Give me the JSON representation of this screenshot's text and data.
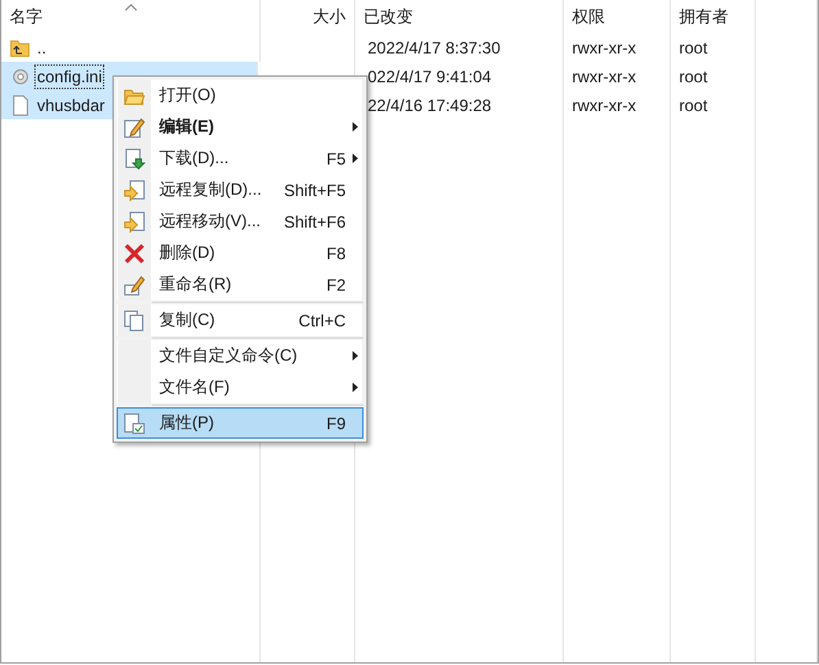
{
  "columns": [
    {
      "label": "名字",
      "sorted": true
    },
    {
      "label": "大小"
    },
    {
      "label": "已改变"
    },
    {
      "label": "权限"
    },
    {
      "label": "拥有者"
    }
  ],
  "rows": [
    {
      "kind": "parent",
      "name": "..",
      "modified": "2022/4/17 8:37:30",
      "permissions": "rwxr-xr-x",
      "owner": "root",
      "selected": false,
      "focused": false
    },
    {
      "kind": "config",
      "name": "config.ini",
      "modified": "022/4/17 9:41:04",
      "permissions": "rwxr-xr-x",
      "owner": "root",
      "selected": true,
      "focused": true
    },
    {
      "kind": "file",
      "name": "vhusbdar",
      "modified": "22/4/16 17:49:28",
      "permissions": "rwxr-xr-x",
      "owner": "root",
      "selected": true,
      "focused": false
    }
  ],
  "context_menu": [
    {
      "kind": "open",
      "label": "打开(O)",
      "submenu": false,
      "bold": false,
      "selected": false
    },
    {
      "kind": "edit",
      "label": "编辑(E)",
      "submenu": true,
      "bold": true,
      "selected": false
    },
    {
      "kind": "download",
      "label": "下载(D)...",
      "shortcut": "F5",
      "submenu": true,
      "bold": false,
      "selected": false
    },
    {
      "kind": "remote-copy",
      "label": "远程复制(D)...",
      "shortcut": "Shift+F5",
      "submenu": false,
      "bold": false,
      "selected": false
    },
    {
      "kind": "remote-move",
      "label": "远程移动(V)...",
      "shortcut": "Shift+F6",
      "submenu": false,
      "bold": false,
      "selected": false
    },
    {
      "kind": "delete",
      "label": "删除(D)",
      "shortcut": "F8",
      "submenu": false,
      "bold": false,
      "selected": false
    },
    {
      "kind": "rename",
      "label": "重命名(R)",
      "shortcut": "F2",
      "submenu": false,
      "bold": false,
      "selected": false,
      "separator_after": true
    },
    {
      "kind": "copy",
      "label": "复制(C)",
      "shortcut": "Ctrl+C",
      "submenu": false,
      "bold": false,
      "selected": false,
      "separator_after": true
    },
    {
      "kind": "plain",
      "label": "文件自定义命令(C)",
      "submenu": true,
      "bold": false,
      "selected": false
    },
    {
      "kind": "plain",
      "label": "文件名(F)",
      "submenu": true,
      "bold": false,
      "selected": false,
      "separator_after": true
    },
    {
      "kind": "properties",
      "label": "属性(P)",
      "shortcut": "F9",
      "submenu": false,
      "bold": false,
      "selected": true
    }
  ]
}
